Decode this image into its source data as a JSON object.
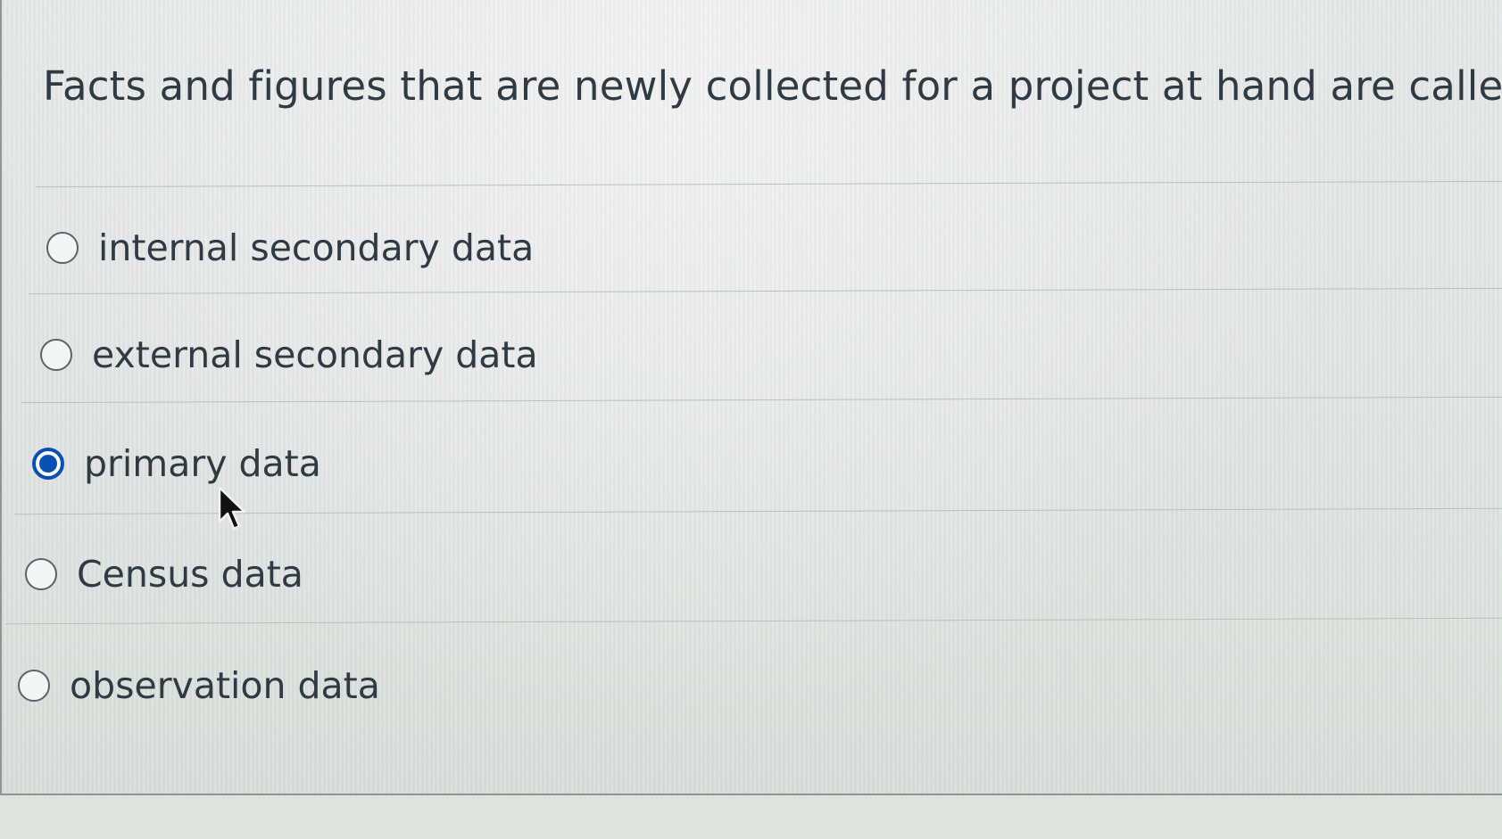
{
  "question": {
    "text": "Facts and figures that are newly collected for a project at hand are called:"
  },
  "options": [
    {
      "label": "internal secondary data",
      "selected": false
    },
    {
      "label": "external secondary data",
      "selected": false
    },
    {
      "label": "primary data",
      "selected": true
    },
    {
      "label": "Census data",
      "selected": false
    },
    {
      "label": "observation data",
      "selected": false
    }
  ],
  "colors": {
    "accent": "#0a4fb3",
    "text": "#2f3a42",
    "divider": "#b9c0bd"
  },
  "icons": {
    "unselected": "radio-empty-icon",
    "selected": "radio-filled-icon",
    "pointer": "mouse-pointer-icon"
  }
}
